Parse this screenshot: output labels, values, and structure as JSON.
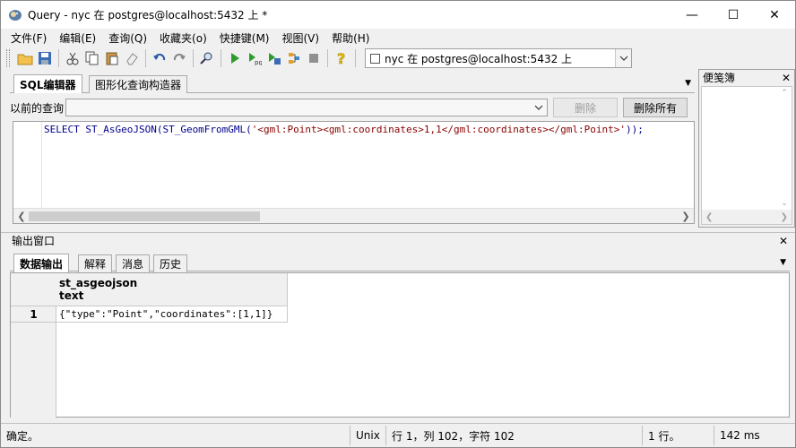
{
  "window": {
    "title": "Query - nyc 在  postgres@localhost:5432 上 *",
    "minimize": "—",
    "maximize": "☐",
    "close": "✕"
  },
  "menu": [
    "文件(F)",
    "编辑(E)",
    "查询(Q)",
    "收藏夹(o)",
    "快捷键(M)",
    "视图(V)",
    "帮助(H)"
  ],
  "toolbar": {
    "icons": [
      "open-folder-icon",
      "save-icon",
      "cut-icon",
      "copy-icon",
      "paste-icon",
      "eraser-icon",
      "undo-icon",
      "redo-icon",
      "find-icon",
      "execute-icon",
      "execute-pgscript-icon",
      "execute-to-file-icon",
      "explain-icon",
      "cancel-icon",
      "help-icon"
    ],
    "connection": "nyc 在  postgres@localhost:5432 上"
  },
  "editor": {
    "tabs": [
      "SQL编辑器",
      "图形化查询构造器"
    ],
    "history_label": "以前的查询",
    "history_value": "",
    "delete_label": "删除",
    "delete_all_label": "删除所有",
    "sql_prefix": "SELECT ST_AsGeoJSON(ST_GeomFromGML(",
    "sql_string": "'<gml:Point><gml:coordinates>1,1</gml:coordinates></gml:Point>'",
    "sql_suffix": "));"
  },
  "scratch_pad": {
    "title": "便笺簿",
    "close": "✕"
  },
  "output": {
    "title": "输出窗口",
    "close": "✕",
    "tabs": [
      "数据输出",
      "解释",
      "消息",
      "历史"
    ],
    "columns": [
      {
        "name": "st_asgeojson",
        "type": "text"
      }
    ],
    "rows": [
      {
        "num": "1",
        "value": "{\"type\":\"Point\",\"coordinates\":[1,1]}"
      }
    ]
  },
  "status": {
    "message": "确定。",
    "line_ending": "Unix",
    "position": "行 1，列 102，字符 102",
    "rows": "1 行。",
    "time": "142 ms"
  },
  "colors": {
    "keyword": "#00008b",
    "string": "#8b0000"
  }
}
